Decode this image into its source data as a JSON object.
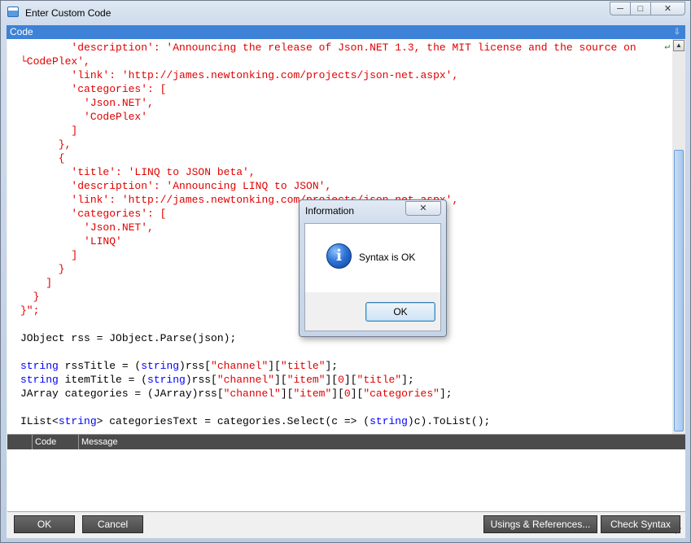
{
  "window": {
    "title": "Enter Custom Code",
    "min_glyph": "─",
    "max_glyph": "□",
    "close_glyph": "✕"
  },
  "code_panel": {
    "header": "Code",
    "pin_glyph": "⇩"
  },
  "code_lines": [
    [
      {
        "t": "s",
        "v": "        'description': 'Announcing the release of Json.NET 1.3, the MIT license and the source on"
      }
    ],
    [
      {
        "t": "s",
        "v": "└CodePlex',"
      }
    ],
    [
      {
        "t": "s",
        "v": "        'link': 'http://james.newtonking.com/projects/json-net.aspx',"
      }
    ],
    [
      {
        "t": "s",
        "v": "        'categories': ["
      }
    ],
    [
      {
        "t": "s",
        "v": "          'Json.NET',"
      }
    ],
    [
      {
        "t": "s",
        "v": "          'CodePlex'"
      }
    ],
    [
      {
        "t": "s",
        "v": "        ]"
      }
    ],
    [
      {
        "t": "s",
        "v": "      },"
      }
    ],
    [
      {
        "t": "s",
        "v": "      {"
      }
    ],
    [
      {
        "t": "s",
        "v": "        'title': 'LINQ to JSON beta',"
      }
    ],
    [
      {
        "t": "s",
        "v": "        'description': 'Announcing LINQ to JSON',"
      }
    ],
    [
      {
        "t": "s",
        "v": "        'link': 'http://james.newtonking.com/projects/json-net.aspx',"
      }
    ],
    [
      {
        "t": "s",
        "v": "        'categories': ["
      }
    ],
    [
      {
        "t": "s",
        "v": "          'Json.NET',"
      }
    ],
    [
      {
        "t": "s",
        "v": "          'LINQ'"
      }
    ],
    [
      {
        "t": "s",
        "v": "        ]"
      }
    ],
    [
      {
        "t": "s",
        "v": "      }"
      }
    ],
    [
      {
        "t": "s",
        "v": "    ]"
      }
    ],
    [
      {
        "t": "s",
        "v": "  }"
      }
    ],
    [
      {
        "t": "s",
        "v": "}\";"
      }
    ],
    [],
    [
      {
        "t": "n",
        "v": "JObject rss = JObject.Parse(json);"
      }
    ],
    [],
    [
      {
        "t": "k",
        "v": "string"
      },
      {
        "t": "n",
        "v": " rssTitle = ("
      },
      {
        "t": "k",
        "v": "string"
      },
      {
        "t": "n",
        "v": ")rss["
      },
      {
        "t": "s",
        "v": "\"channel\""
      },
      {
        "t": "n",
        "v": "]["
      },
      {
        "t": "s",
        "v": "\"title\""
      },
      {
        "t": "n",
        "v": "];"
      }
    ],
    [
      {
        "t": "k",
        "v": "string"
      },
      {
        "t": "n",
        "v": " itemTitle = ("
      },
      {
        "t": "k",
        "v": "string"
      },
      {
        "t": "n",
        "v": ")rss["
      },
      {
        "t": "s",
        "v": "\"channel\""
      },
      {
        "t": "n",
        "v": "]["
      },
      {
        "t": "s",
        "v": "\"item\""
      },
      {
        "t": "n",
        "v": "]["
      },
      {
        "t": "s",
        "v": "0"
      },
      {
        "t": "n",
        "v": "]["
      },
      {
        "t": "s",
        "v": "\"title\""
      },
      {
        "t": "n",
        "v": "];"
      }
    ],
    [
      {
        "t": "n",
        "v": "JArray categories = (JArray)rss["
      },
      {
        "t": "s",
        "v": "\"channel\""
      },
      {
        "t": "n",
        "v": "]["
      },
      {
        "t": "s",
        "v": "\"item\""
      },
      {
        "t": "n",
        "v": "]["
      },
      {
        "t": "s",
        "v": "0"
      },
      {
        "t": "n",
        "v": "]["
      },
      {
        "t": "s",
        "v": "\"categories\""
      },
      {
        "t": "n",
        "v": "];"
      }
    ],
    [],
    [
      {
        "t": "n",
        "v": "IList<"
      },
      {
        "t": "k",
        "v": "string"
      },
      {
        "t": "n",
        "v": "> categoriesText = categories.Select(c => ("
      },
      {
        "t": "k",
        "v": "string"
      },
      {
        "t": "n",
        "v": ")c).ToList();"
      }
    ]
  ],
  "wrap_marker": "↵",
  "error_list": {
    "columns": [
      "",
      "Code",
      "Message"
    ],
    "rows": []
  },
  "buttons": {
    "ok": "OK",
    "cancel": "Cancel",
    "usings": "Usings & References...",
    "check_syntax": "Check Syntax"
  },
  "dialog": {
    "title": "Information",
    "close_glyph": "✕",
    "icon": "info-icon",
    "icon_glyph": "i",
    "message": "Syntax is OK",
    "ok_label": "OK"
  },
  "colors": {
    "header_blue": "#3d82d7",
    "string_red": "#e00000",
    "keyword_blue": "#0000ff",
    "button_dark": "#4a4a4a"
  }
}
